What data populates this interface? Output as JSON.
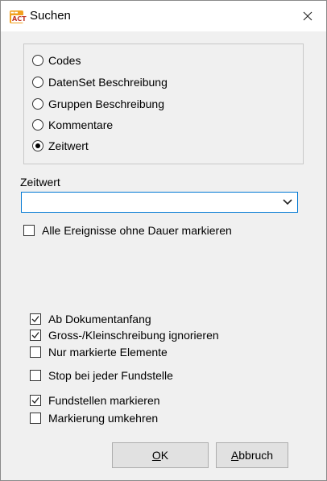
{
  "window": {
    "title": "Suchen",
    "icon": "app-logo-icon",
    "icon_text_top": "Mangold",
    "icon_text_bottom": "ACT"
  },
  "search_in": {
    "options": [
      {
        "label": "Codes",
        "selected": false
      },
      {
        "label": "DatenSet Beschreibung",
        "selected": false
      },
      {
        "label": "Gruppen Beschreibung",
        "selected": false
      },
      {
        "label": "Kommentare",
        "selected": false
      },
      {
        "label": "Zeitwert",
        "selected": true
      }
    ]
  },
  "field": {
    "label": "Zeitwert",
    "value": ""
  },
  "mark_without_duration": {
    "label": "Alle Ereignisse ohne Dauer markieren",
    "checked": false
  },
  "options": [
    {
      "label": "Ab Dokumentanfang",
      "checked": true
    },
    {
      "label": "Gross-/Kleinschreibung ignorieren",
      "checked": true
    },
    {
      "label": "Nur markierte Elemente",
      "checked": false
    },
    {
      "label": "Stop bei jeder Fundstelle",
      "checked": false
    },
    {
      "label": "Fundstellen markieren",
      "checked": true
    },
    {
      "label": "Markierung umkehren",
      "checked": false
    }
  ],
  "buttons": {
    "ok": {
      "mnemonic": "O",
      "rest": "K"
    },
    "cancel": {
      "mnemonic": "A",
      "rest": "bbruch"
    }
  }
}
